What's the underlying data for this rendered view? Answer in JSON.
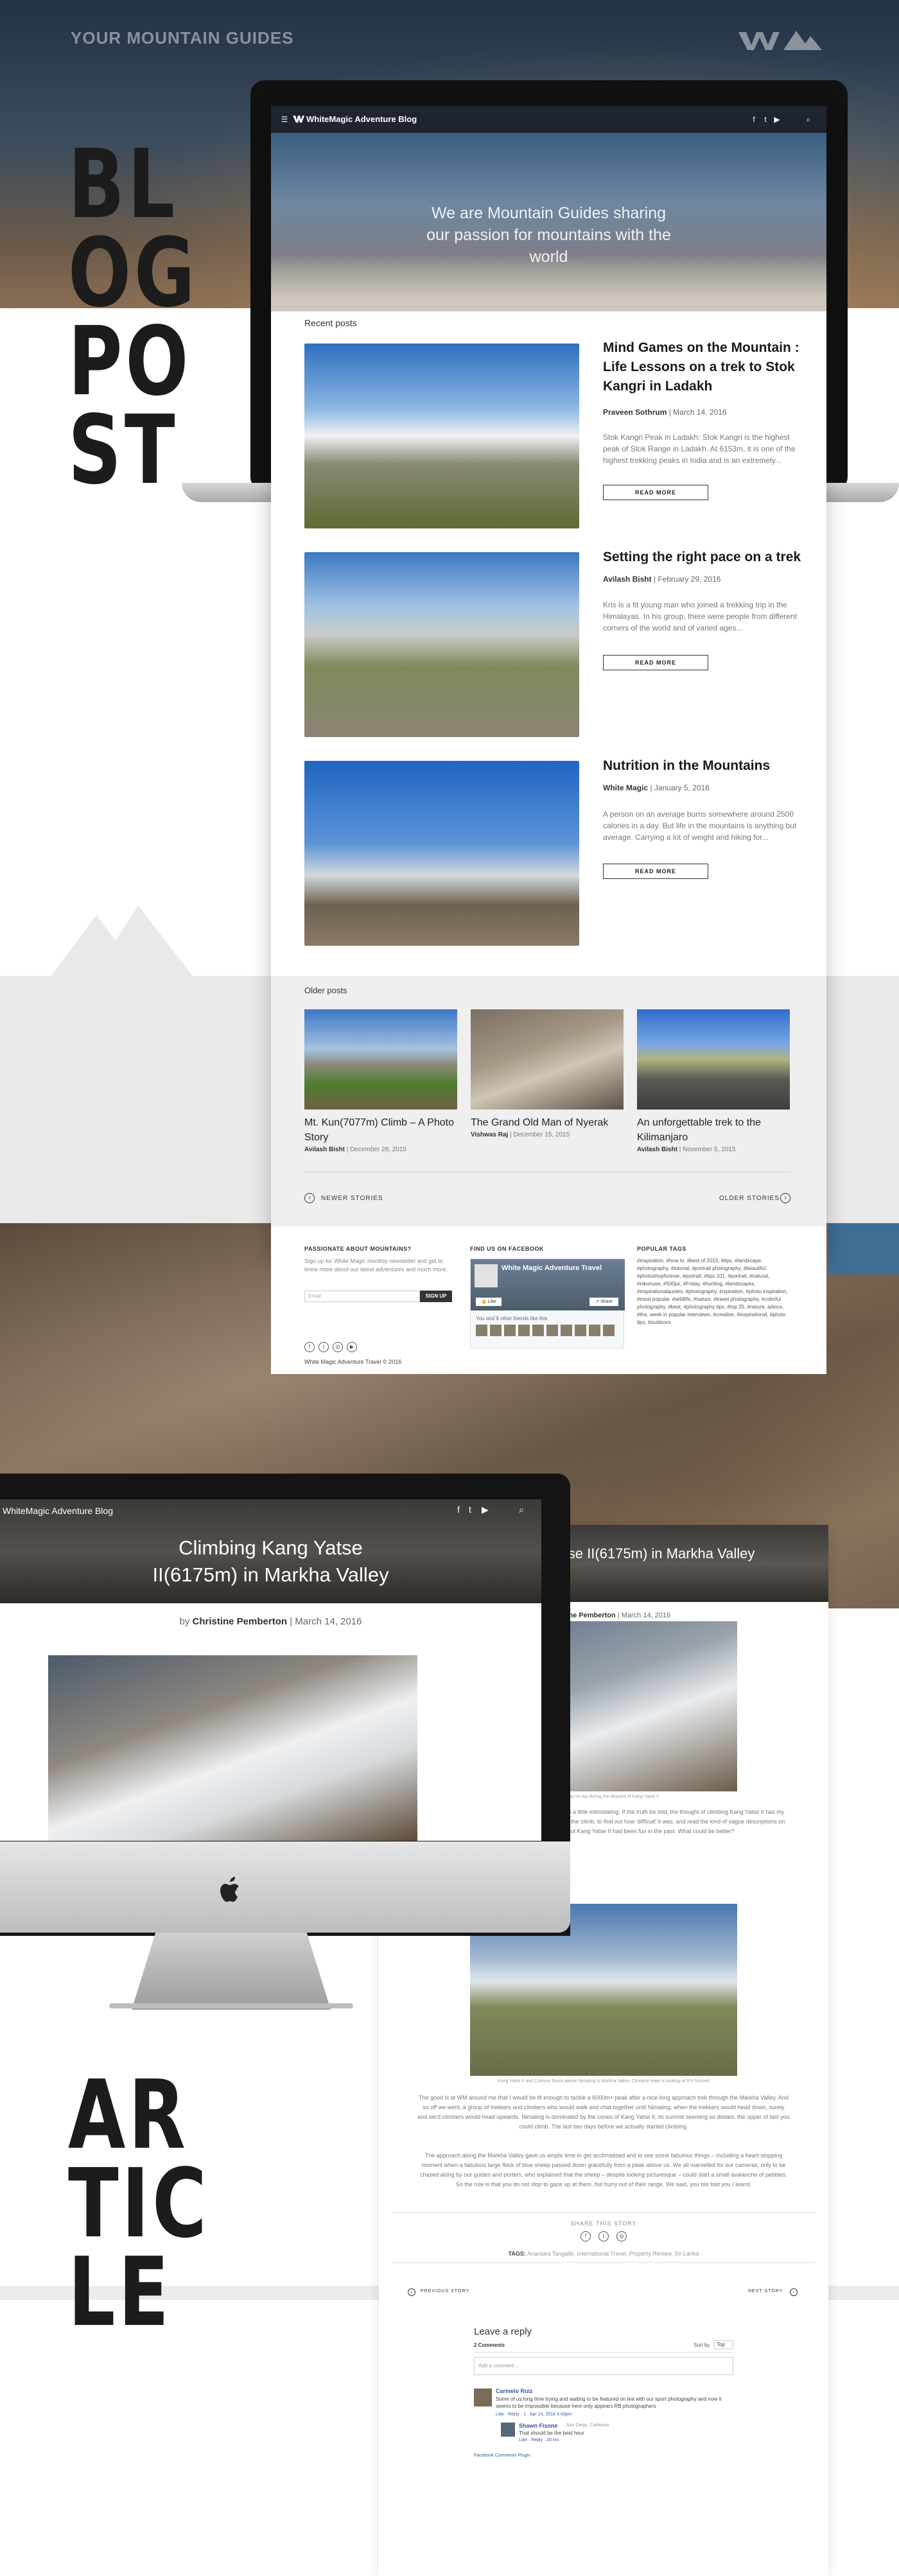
{
  "showcase": {
    "brand_tagline": "YOUR MOUNTAIN GUIDES",
    "label_blog": [
      "BL",
      "OG",
      "PO",
      "ST"
    ],
    "label_article": [
      "AR",
      "TIC",
      "LE"
    ]
  },
  "blog": {
    "navbar": {
      "title": "WhiteMagic Adventure Blog",
      "icons": [
        "menu-icon",
        "facebook-icon",
        "twitter-icon",
        "youtube-icon",
        "search-icon"
      ]
    },
    "hero_title": "We are Mountain Guides sharing our passion for mountains with the world",
    "recent_heading": "Recent posts",
    "read_more": "READ MORE",
    "recent_posts": [
      {
        "title": "Mind Games on the Mountain : Life Lessons on a trek to Stok Kangri in Ladakh",
        "author": "Praveen Sothrum",
        "date": "March 14, 2016",
        "excerpt": "Stok Kangri Peak in Ladakh: Stok Kangri is the highest peak of Stok Range in Ladakh. At 6153m, it is one of the highest trekking peaks in India and is an extremely..."
      },
      {
        "title": "Setting the right pace on a trek",
        "author": "Avilash Bisht",
        "date": "February 29, 2016",
        "excerpt": "Kris is a fit young man who joined a trekking trip in the Himalayas. In his group, there were people from different corners of the world and of varied ages..."
      },
      {
        "title": "Nutrition in the Mountains",
        "author": "White Magic",
        "date": "January 5, 2016",
        "excerpt": "A person on an average burns somewhere around 2500 calories in a day. But life in the mountains is anything but average. Carrying a lot of weight and hiking for..."
      }
    ],
    "older_heading": "Older posts",
    "older_posts": [
      {
        "title": "Mt. Kun(7077m) Climb – A Photo Story",
        "author": "Avilash Bisht",
        "date": "December 28, 2015"
      },
      {
        "title": "The Grand Old Man of Nyerak",
        "author": "Vishwas Raj",
        "date": "December 15, 2015"
      },
      {
        "title": "An unforgettable trek to the Kilimanjaro",
        "author": "Avilash Bisht",
        "date": "November 5, 2015"
      }
    ],
    "pager": {
      "newer": "NEWER STORIES",
      "older": "OLDER STORIES"
    },
    "footer": {
      "newsletter_heading": "PASSIONATE ABOUT MOUNTAINS?",
      "newsletter_text": "Sign up for White Magic monthly newsletter and get to know more about our latest adventures and much more.",
      "email_placeholder": "Email",
      "signup": "SIGN UP",
      "copyright": "White Magic Adventure Travel © 2016",
      "facebook_heading": "FIND US ON FACEBOOK",
      "facebook_page": "White Magic Adventure Travel",
      "facebook_likes": "You and 9 other friends like this",
      "facebook_like": "Like",
      "facebook_share": "Share",
      "tags_heading": "POPULAR TAGS",
      "tags": "#inspiration, #how to, #best of 2015, #tips, #landscape, #photography, #tutorial, #portrait photography, #beautiful, #photoshopforever, #portrait, #tips 101, #portrait, #natural, #nikonuse, #500px, #Friday, #hunting, #landscapes, #inspirationalquotes, #photography, inspiration, #photo inspiration, #most popular, #wildlife, #nature, #travel photography, #colorful photography, #best, #photography tips, #top 25, #nature, advice, #the, week in popular interviews, #creative, #inspirational, #photo tips, #outdoors"
    }
  },
  "article": {
    "navbar_title": "WhiteMagic Adventure Blog",
    "title": "Climbing Kang Yatse II(6175m) in Markha Valley",
    "author": "Christine Pemberton",
    "date": "March 14, 2016",
    "caption_1": "Vinay Kumar on top during the descent of Kang Yatse II",
    "caption_2": "Kang Yatse II and Cosmos Ruins above Nimaling & Markha Valley. Christine team is looking at R's Summit",
    "body_1": "Climbing Himalayan peaks is seriously exciting – and also a little intimidating. If the truth be told, the thought of climbing Kang Yatse II has my nerves on edge. I have instantly hit the internet, to google the climb, to find out how 'difficult' it was, and read the kind of vague descriptions on offer, and all a bit vague. Thinking about Kang Yatse II had been fun in the past. What could be better?",
    "body_2": "The good is at WM around me that I would be fit enough to tackle a 6000m+ peak after a nice long approach trek through the Markha Valley. And so off we went, a group of trekkers and climbers who would walk and chat together until Nimaling, when the trekkers would head down, surely and we'd climbers would head upwards. Nimaling is dominated by the cones of Kang Yatse II, its summit seeming so distant, the upper of last you could climb. The last two days before we actually started climbing.",
    "body_3": "The approach along the Markha Valley gave us ample time to get acclimatised and to see some fabulous things – including a heart-stopping moment when a fabulous large flock of blue sheep passed down gracefully from a peak above us. We all marvelled for our cameras, only to be chased along by our guides and porters, who explained that the sheep – despite looking picturesque – could start a small avalanche of pebbles. So the rule is that you do not stop to gaze up at them, but hurry out of their range. We said, you too told you I learnt.",
    "share_heading": "SHARE THIS STORY",
    "tags_label": "TAGS:",
    "tags": "Anantara Tangalle, International Travel, Property Review, Sri Lanka",
    "prev_story": "PREVIOUS STORY",
    "next_story": "NEXT STORY",
    "leave_reply": "Leave a reply",
    "comments_count": "2 Comments",
    "sort_by": "Sort by",
    "sort_value": "Top",
    "comment_placeholder": "Add a comment...",
    "comments": [
      {
        "name": "Carmelo Ruiz",
        "text": "Some of us long time trying and waiting to be featured on tea with our sport photography and now it seems to be impossible because here only appears RB photographers",
        "actions": "Like · Reply · 1 · Apr 14, 2016 4:43pm"
      },
      {
        "name": "Shawn Fisone",
        "meta": "San Diego, California",
        "text": "That should be the best hour",
        "actions": "Like · Reply · 20 hrs"
      }
    ],
    "fb_plugin": "Facebook Comments Plugin"
  },
  "colors": {
    "navbar": "#1e2430",
    "page_bg": "#ffffff",
    "grey_band": "#e9e9e9",
    "text_dark": "#1a1a1a",
    "link": "#3b5998"
  }
}
